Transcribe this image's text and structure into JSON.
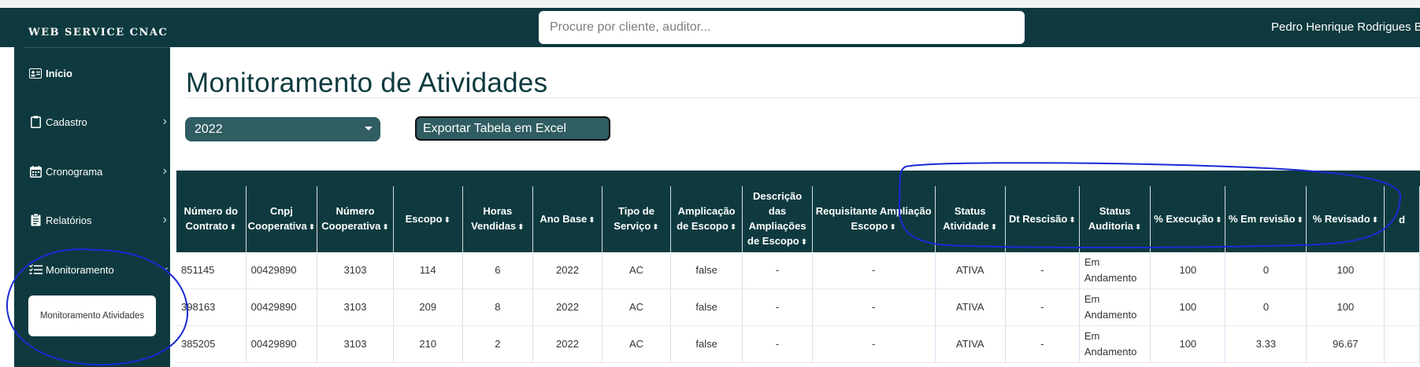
{
  "sidebar": {
    "brand": "WEB SERVICE CNAC",
    "items": [
      {
        "label": "Início",
        "icon": "id-card-icon"
      },
      {
        "label": "Cadastro",
        "icon": "clipboard-icon"
      },
      {
        "label": "Cronograma",
        "icon": "calendar-icon"
      },
      {
        "label": "Relatórios",
        "icon": "report-icon"
      },
      {
        "label": "Monitoramento",
        "icon": "checklist-icon"
      }
    ],
    "submenu": {
      "label": "Monitoramento Atividades"
    }
  },
  "header": {
    "search_placeholder": "Procure por cliente, auditor...",
    "user_name": "Pedro Henrique Rodrigues Be"
  },
  "main": {
    "title": "Monitoramento de Atividades",
    "year_select": {
      "selected": "2022"
    },
    "export_label": "Exportar Tabela em Excel"
  },
  "table": {
    "columns": [
      "Número do Contrato",
      "Cnpj Cooperativa",
      "Número Cooperativa",
      "Escopo",
      "Horas Vendidas",
      "Ano Base",
      "Tipo de Serviço",
      "Amplicação de Escopo",
      "Descrição das Ampliações de Escopo",
      "Requisitante Ampliação Escopo",
      "Status Atividade",
      "Dt Rescisão",
      "Status Auditoria",
      "% Execução",
      "% Em revisão",
      "% Revisado",
      "d"
    ],
    "rows": [
      [
        "851145",
        "00429890",
        "3103",
        "114",
        "6",
        "2022",
        "AC",
        "false",
        "-",
        "-",
        "ATIVA",
        "-",
        "Em Andamento",
        "100",
        "0",
        "100",
        ""
      ],
      [
        "398163",
        "00429890",
        "3103",
        "209",
        "8",
        "2022",
        "AC",
        "false",
        "-",
        "-",
        "ATIVA",
        "-",
        "Em Andamento",
        "100",
        "0",
        "100",
        ""
      ],
      [
        "385205",
        "00429890",
        "3103",
        "210",
        "2",
        "2022",
        "AC",
        "false",
        "-",
        "-",
        "ATIVA",
        "-",
        "Em Andamento",
        "100",
        "3.33",
        "96.67",
        ""
      ]
    ]
  },
  "colors": {
    "primary": "#0e3a3f",
    "control": "#2f5d61",
    "annotation": "#1a2ad4"
  }
}
